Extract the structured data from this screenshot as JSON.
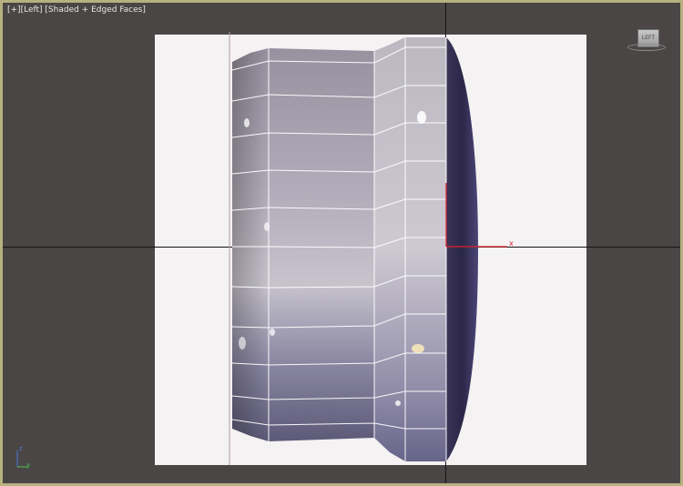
{
  "viewport": {
    "label_plus": "[+]",
    "label_view": "[Left]",
    "label_shading": "[Shaded + Edged Faces]"
  },
  "viewcube": {
    "face_label": "LEFT"
  },
  "gizmo": {
    "x_label": "x"
  },
  "axis_tripod": {
    "y_label": "y",
    "z_label": "z"
  },
  "colors": {
    "viewport_bg": "#4a4646",
    "viewport_border": "#b7b180",
    "reference_bg": "#f4f2f2",
    "wireframe": "#ffffff",
    "gizmo_red": "#e0202a",
    "dark_rim": "#2c2848"
  }
}
